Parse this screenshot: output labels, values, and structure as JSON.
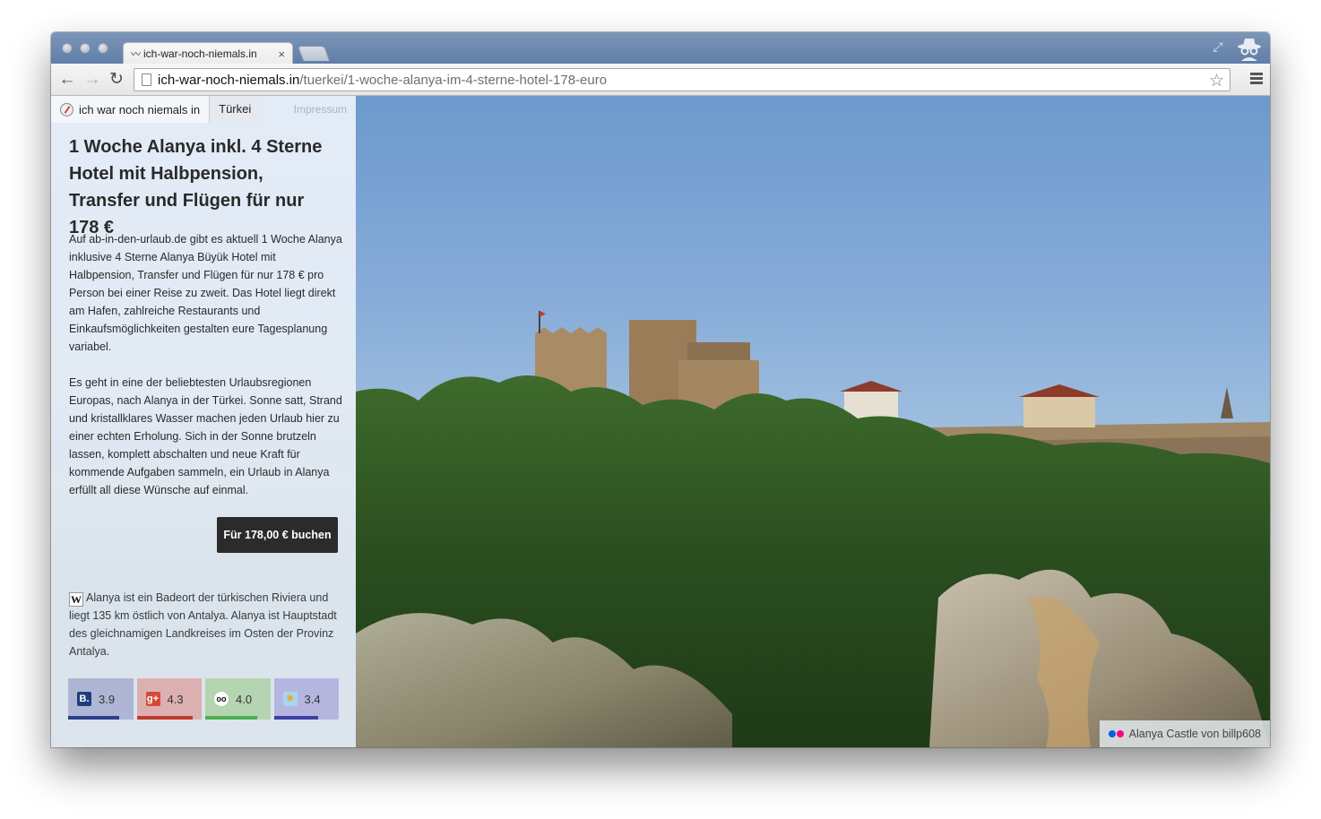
{
  "browser": {
    "tab": {
      "favicon": "mustache-icon",
      "title": "ich-war-noch-niemals.in"
    },
    "url": {
      "host": "ich-war-noch-niemals.in",
      "path": "/tuerkei/1-woche-alanya-im-4-sterne-hotel-178-euro"
    }
  },
  "nav": {
    "home": "ich war noch niemals in",
    "country": "Türkei",
    "impressum": "Impressum"
  },
  "article": {
    "title": "1 Woche Alanya inkl. 4 Sterne Hotel mit Halbpension, Transfer und Flügen für nur 178 €",
    "paragraph1": "Auf ab-in-den-urlaub.de gibt es aktuell 1 Woche Alanya inklusive 4 Sterne Alanya Büyük Hotel mit Halbpension, Transfer und Flügen für nur 178 € pro Person bei einer Reise zu zweit. Das Hotel liegt direkt am Hafen, zahlreiche Restaurants und Einkaufsmöglichkeiten gestalten eure Tagesplanung variabel.",
    "paragraph2": "Es geht in eine der beliebtesten Urlaubsregionen Europas, nach Alanya in der Türkei. Sonne satt, Strand und kristallklares Wasser machen jeden Urlaub hier zu einer echten Erholung. Sich in der Sonne brutzeln lassen, komplett abschalten und neue Kraft für kommende Aufgaben sammeln, ein Urlaub in Alanya erfüllt all diese Wünsche auf einmal.",
    "book_button": "Für 178,00 € buchen",
    "wiki_icon": "W",
    "wiki_text": "Alanya ist ein Badeort der türkischen Riviera und liegt 135 km östlich von Antalya. Alanya ist Hauptstadt des gleichnamigen Landkreises im Osten der Provinz Antalya."
  },
  "ratings": [
    {
      "source": "booking-icon",
      "icon_text": "B.",
      "score": "3.9",
      "fill": 0.78,
      "color": "#2c3e8c"
    },
    {
      "source": "google-plus-icon",
      "icon_text": "g+",
      "score": "4.3",
      "fill": 0.86,
      "color": "#c0392b"
    },
    {
      "source": "tripadvisor-icon",
      "icon_text": "oo",
      "score": "4.0",
      "fill": 0.8,
      "color": "#4caf50"
    },
    {
      "source": "holidaycheck-icon",
      "icon_text": "☀",
      "score": "3.4",
      "fill": 0.68,
      "color": "#3f3fa8"
    }
  ],
  "photo_credit": {
    "icon": "flickr-icon",
    "text": "Alanya Castle von billp608"
  }
}
